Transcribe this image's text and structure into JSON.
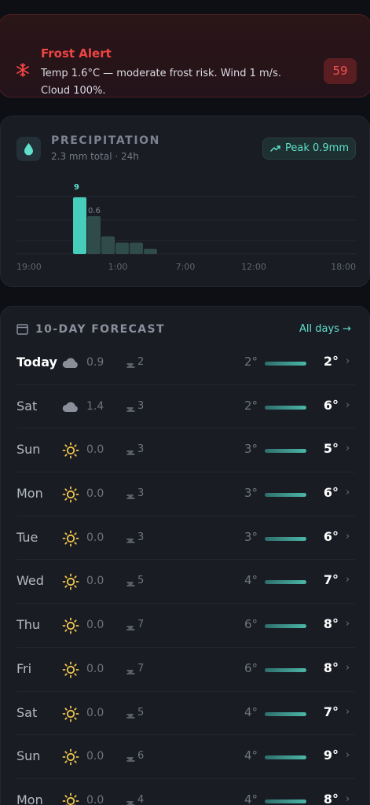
{
  "alert": {
    "title": "Frost Alert",
    "message": "Temp 1.6°C — moderate frost risk. Wind 1 m/s. Cloud 100%.",
    "badge": "59",
    "icon": "snowflake-icon",
    "color": "#ef4444"
  },
  "precipitation": {
    "title": "PRECIPITATION",
    "subtitle": "2.3 mm total · 24h",
    "peak_label": "Peak 0.9mm",
    "icon": "droplet-icon",
    "accent": "#5ee0cd",
    "chart_data": {
      "type": "bar",
      "x": [
        "19:00",
        "20:00",
        "21:00",
        "22:00",
        "23:00",
        "0:00",
        "1:00",
        "2:00",
        "3:00",
        "4:00",
        "5:00",
        "6:00",
        "7:00",
        "8:00",
        "9:00",
        "10:00",
        "11:00",
        "12:00",
        "13:00",
        "14:00",
        "15:00",
        "16:00",
        "17:00",
        "18:00"
      ],
      "values": [
        0,
        0,
        0,
        0.9,
        0.6,
        0.28,
        0.18,
        0.18,
        0.08,
        0,
        0,
        0,
        0,
        0,
        0,
        0,
        0,
        0,
        0,
        0,
        0,
        0,
        0,
        0
      ],
      "data_labels": [
        {
          "index": 3,
          "text": "0.\n9"
        },
        {
          "index": 4,
          "text": "0.6"
        }
      ],
      "tick_labels": [
        "19:00",
        "1:00",
        "7:00",
        "12:00",
        "18:00"
      ],
      "tick_indices": [
        0,
        6,
        12,
        17,
        23
      ],
      "ylim": [
        0,
        0.9
      ],
      "grid": true
    }
  },
  "forecast": {
    "title": "10-DAY FORECAST",
    "all_days_label": "All days →",
    "rows": [
      {
        "day": "Today",
        "icon": "cloud-icon",
        "precip": "0.9",
        "wind": "2",
        "lo": "2°",
        "hi": "2°"
      },
      {
        "day": "Sat",
        "icon": "cloud-icon",
        "precip": "1.4",
        "wind": "3",
        "lo": "2°",
        "hi": "6°"
      },
      {
        "day": "Sun",
        "icon": "sun-icon",
        "precip": "0.0",
        "wind": "3",
        "lo": "3°",
        "hi": "5°"
      },
      {
        "day": "Mon",
        "icon": "sun-icon",
        "precip": "0.0",
        "wind": "3",
        "lo": "3°",
        "hi": "6°"
      },
      {
        "day": "Tue",
        "icon": "sun-icon",
        "precip": "0.0",
        "wind": "3",
        "lo": "3°",
        "hi": "6°"
      },
      {
        "day": "Wed",
        "icon": "sun-icon",
        "precip": "0.0",
        "wind": "5",
        "lo": "4°",
        "hi": "7°"
      },
      {
        "day": "Thu",
        "icon": "sun-icon",
        "precip": "0.0",
        "wind": "7",
        "lo": "6°",
        "hi": "8°"
      },
      {
        "day": "Fri",
        "icon": "sun-icon",
        "precip": "0.0",
        "wind": "7",
        "lo": "6°",
        "hi": "8°"
      },
      {
        "day": "Sat",
        "icon": "sun-icon",
        "precip": "0.0",
        "wind": "5",
        "lo": "4°",
        "hi": "7°"
      },
      {
        "day": "Sun",
        "icon": "sun-icon",
        "precip": "0.0",
        "wind": "6",
        "lo": "4°",
        "hi": "9°"
      },
      {
        "day": "Mon",
        "icon": "sun-icon",
        "precip": "0.0",
        "wind": "4",
        "lo": "4°",
        "hi": "8°"
      }
    ]
  }
}
